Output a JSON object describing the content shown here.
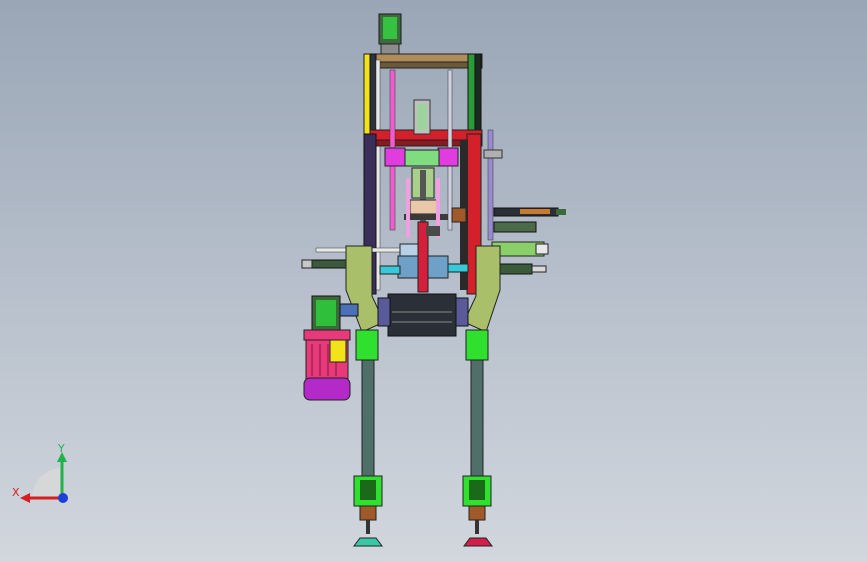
{
  "viewport": {
    "background_top": "#9aa6b6",
    "background_bottom": "#d2d7de"
  },
  "triad": {
    "x_label": "X",
    "y_label": "Y",
    "x_color": "#d81e1e",
    "y_color": "#22b24c",
    "z_color": "#1e3fd8"
  },
  "colors": {
    "frame_yellow": "#f2e21a",
    "frame_red": "#d4202a",
    "frame_green": "#2a9a3a",
    "frame_dark": "#2b3240",
    "olive_bracket": "#a9bf6a",
    "magenta_parts": "#e03ce0",
    "cyan_parts": "#38c8d8",
    "motor_pink": "#e8397a",
    "motor_purple": "#b32ac9",
    "leg_green": "#2fe02f",
    "leg_rod": "#506f68",
    "dark_block": "#2b2f37"
  }
}
